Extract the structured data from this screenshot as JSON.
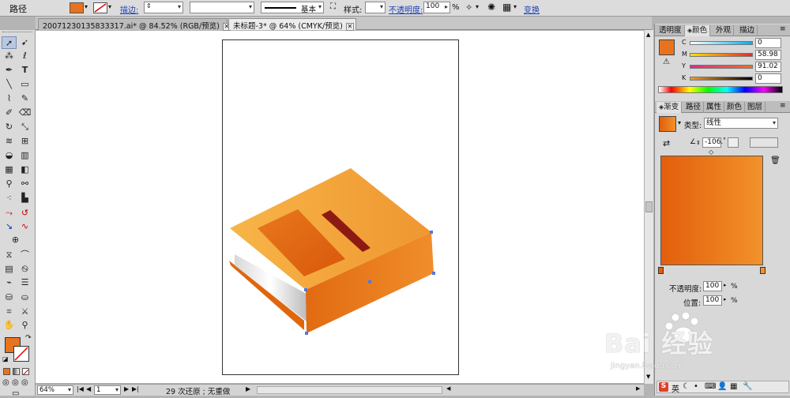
{
  "control_bar": {
    "selection_label": "路径",
    "fill_color": "#e8731e",
    "stroke_label": "描边:",
    "stroke_weight_value": "",
    "stroke_profile_value": "",
    "brush_label": "基本",
    "style_label": "样式:",
    "opacity_label": "不透明度:",
    "opacity_value": "100",
    "opacity_unit": "%",
    "transform_link": "变换"
  },
  "document_tabs": [
    {
      "label": "20071230135833317.ai* @ 84.52% (RGB/预览)",
      "active": false
    },
    {
      "label": "未标题-3* @ 64% (CMYK/预览)",
      "active": true
    }
  ],
  "status_bar": {
    "zoom_value": "64%",
    "page_value": "1",
    "status_text": "29 次还原 ; 无重做"
  },
  "color_panel": {
    "tabs": [
      "透明度",
      "颜色",
      "外观",
      "描边"
    ],
    "active_tab": "颜色",
    "channels": [
      {
        "label": "C",
        "value": "0"
      },
      {
        "label": "M",
        "value": "58.98"
      },
      {
        "label": "Y",
        "value": "91.02"
      },
      {
        "label": "K",
        "value": "0"
      }
    ]
  },
  "gradient_panel": {
    "tabs": [
      "渐变",
      "路径",
      "属性",
      "颜色",
      "图层"
    ],
    "active_tab": "渐变",
    "type_label": "类型:",
    "type_value": "线性",
    "angle_value": "-106.",
    "angle_unit": "°",
    "opacity_label": "不透明度:",
    "opacity_value": "100",
    "opacity_unit": "%",
    "position_label": "位置:",
    "position_value": "100",
    "position_unit": "%",
    "gradient_start": "#e25e0c",
    "gradient_end": "#f2922a"
  },
  "watermark": {
    "brand": "Bai 经验",
    "url": "jingyan.baidu.com"
  },
  "ime_bar": {
    "label": "英"
  }
}
